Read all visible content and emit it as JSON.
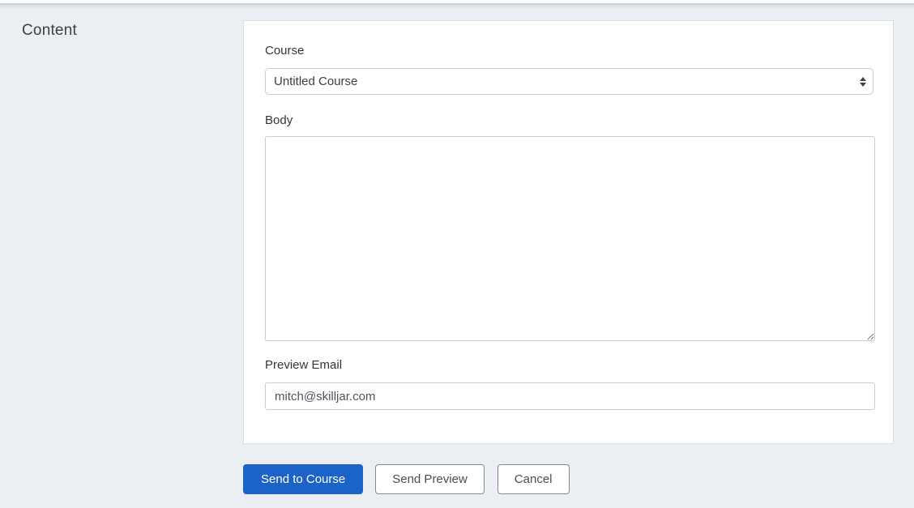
{
  "section": {
    "title": "Content"
  },
  "form": {
    "course": {
      "label": "Course",
      "value": "Untitled Course"
    },
    "body": {
      "label": "Body",
      "value": ""
    },
    "preview_email": {
      "label": "Preview Email",
      "value": "mitch@skilljar.com"
    }
  },
  "buttons": {
    "send_to_course": "Send to Course",
    "send_preview": "Send Preview",
    "cancel": "Cancel"
  },
  "icons": {
    "select_arrows": "select-arrows-icon",
    "resize_handle": "textarea-resize-handle"
  },
  "colors": {
    "primary_button": "#1c63c8",
    "page_background": "#ebeef2",
    "card_background": "#ffffff",
    "card_border": "#d9dce0",
    "input_border": "#c9cdd2",
    "label_text": "#31363c",
    "value_text": "#4d545c",
    "secondary_button_border": "#82898f",
    "secondary_button_text": "#494f56",
    "section_title_text": "#3b4047"
  }
}
